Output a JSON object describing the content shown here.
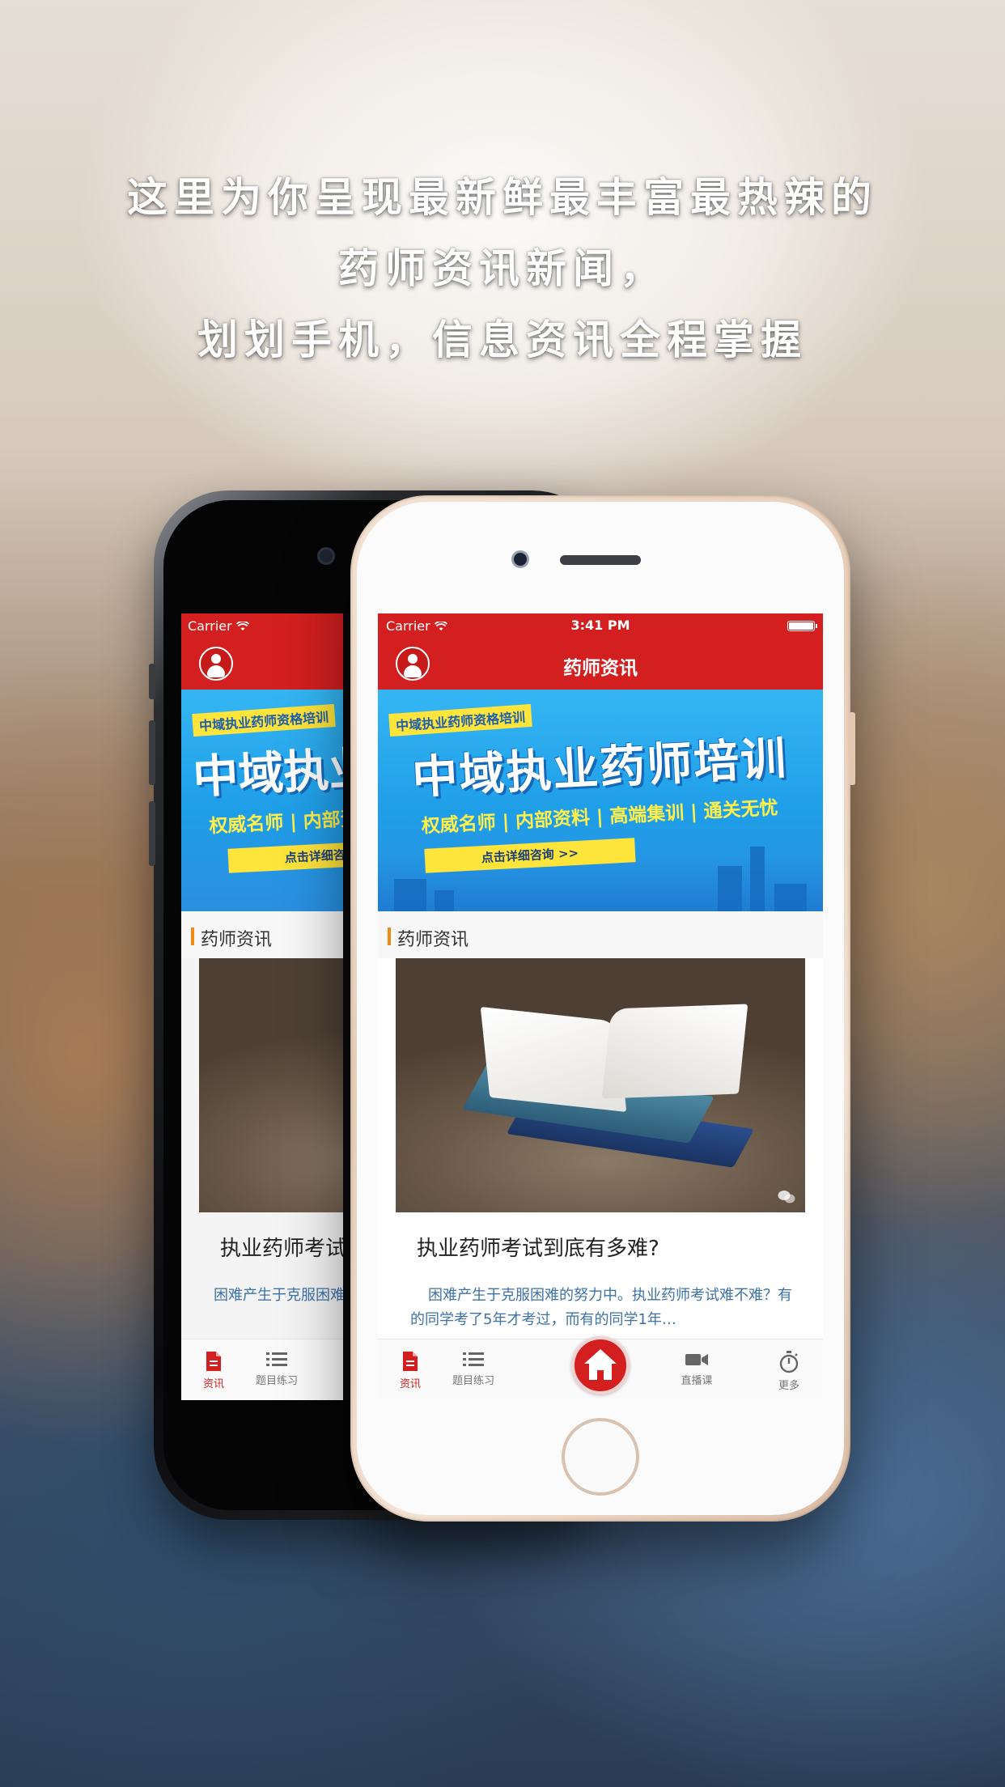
{
  "headline": {
    "line1": "这里为你呈现最新鲜最丰富最热辣的",
    "line2": "药师资讯新闻，",
    "line3": "划划手机，信息资讯全程掌握"
  },
  "status_bar": {
    "carrier": "Carrier",
    "time": "3:41 PM"
  },
  "nav": {
    "title": "药师资讯",
    "avatar_icon": "user-icon"
  },
  "banner": {
    "tag": "中域执业药师资格培训",
    "headline": "中域执业药师培训",
    "subline": "权威名师 | 内部资料 | 高端集训 | 通关无忧",
    "cta": "点击详细咨询 >>"
  },
  "section": {
    "label": "药师资讯"
  },
  "article": {
    "title": "执业药师考试到底有多难?",
    "summary": "困难产生于克服困难的努力中。执业药师考试难不难？有的同学考了5年才考过，而有的同学1年…"
  },
  "tabs": [
    {
      "label": "资讯",
      "icon": "document-icon",
      "active": true
    },
    {
      "label": "题目练习",
      "icon": "list-icon",
      "active": false
    },
    {
      "label": "",
      "icon": "home-icon",
      "active": false
    },
    {
      "label": "直播课",
      "icon": "video-camera-icon",
      "active": false
    },
    {
      "label": "更多",
      "icon": "stopwatch-icon",
      "active": false
    }
  ],
  "colors": {
    "brand_red": "#d31f1f",
    "section_accent": "#f08a16",
    "summary_blue": "#3e72a8"
  }
}
